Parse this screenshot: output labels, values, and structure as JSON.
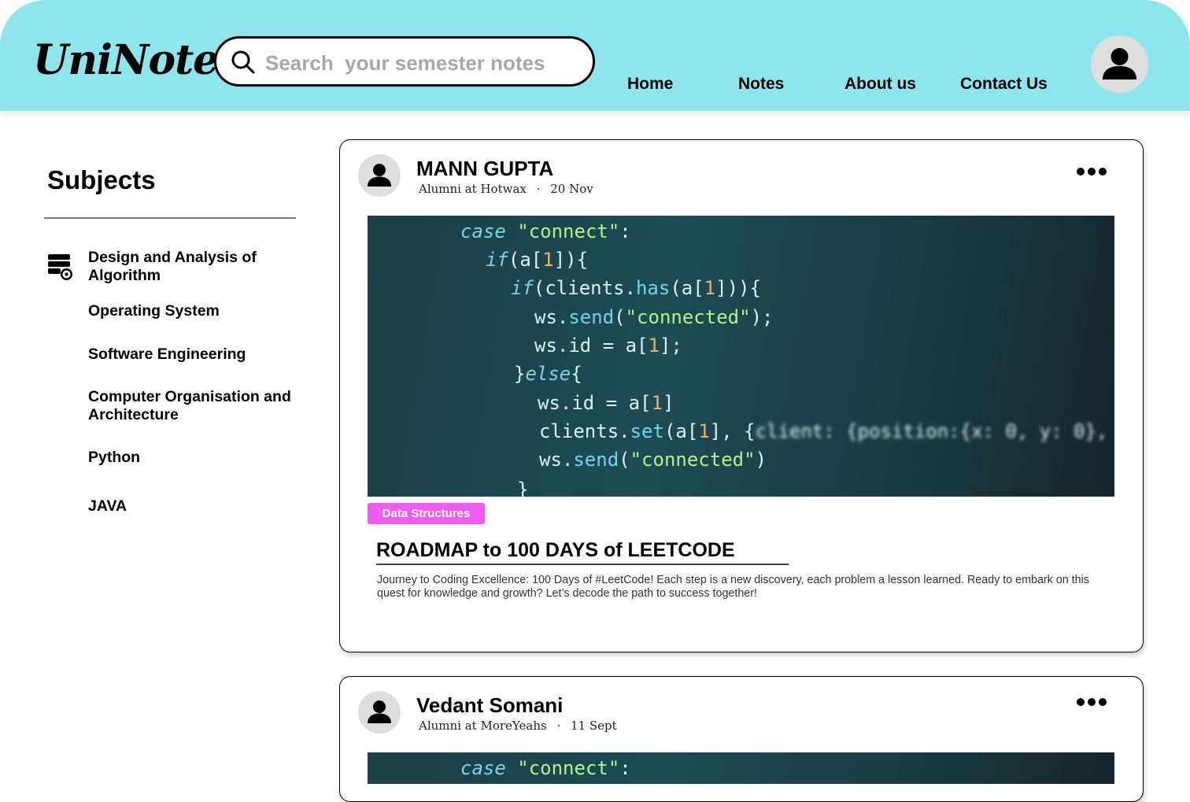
{
  "header": {
    "logo": "UniNote",
    "search_placeholder": "Search  your semester notes",
    "nav": [
      "Home",
      "Notes",
      "About us",
      "Contact Us"
    ]
  },
  "sidebar": {
    "title": "Subjects",
    "subjects": [
      "Design and Analysis of Algorithm",
      "Operating System",
      "Software Engineering",
      "Computer Organisation and Architecture",
      "Python",
      "JAVA"
    ]
  },
  "posts": [
    {
      "author": "MANN GUPTA",
      "role": "Alumni at Hotwax",
      "separator": "·",
      "date": "20 Nov",
      "tag": "Data Structures",
      "title": "ROADMAP to 100 DAYS of LEETCODE",
      "body": "Journey to Coding Excellence: 100 Days of #LeetCode! Each step is a new discovery, each problem a lesson learned. Ready to embark on this quest for knowledge and growth? Let’s decode the path to success together!"
    },
    {
      "author": "Vedant Somani",
      "role": "Alumni at MoreYeahs",
      "separator": "·",
      "date": "11 Sept"
    }
  ],
  "colors": {
    "header_bg": "#8ee6ec",
    "tag_bg": "#f15cf0",
    "avatar_bg": "#dedede"
  }
}
